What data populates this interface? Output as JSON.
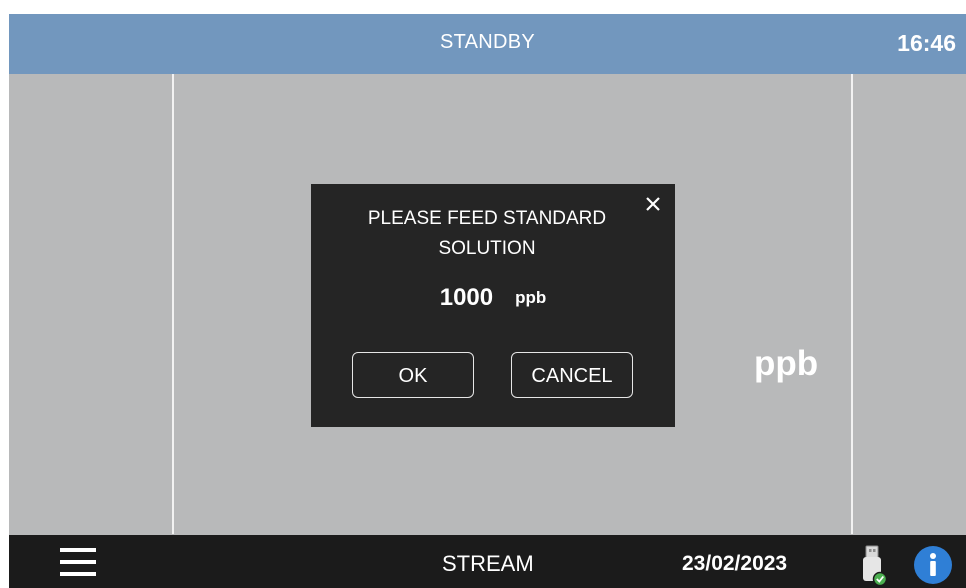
{
  "header": {
    "status": "STANDBY",
    "time": "16:46"
  },
  "main": {
    "unit_label": "ppb"
  },
  "dialog": {
    "message_line1": "PLEASE FEED STANDARD",
    "message_line2": "SOLUTION",
    "value": "1000",
    "unit": "ppb",
    "ok_label": "OK",
    "cancel_label": "CANCEL",
    "close_icon": "close-icon"
  },
  "footer": {
    "menu_icon": "hamburger-menu-icon",
    "stream_label": "STREAM",
    "date": "23/02/2023",
    "usb_icon": "usb-drive-connected-icon",
    "info_icon": "info-icon"
  },
  "colors": {
    "header_bg": "#7297be",
    "main_bg": "#b8b9ba",
    "dialog_bg": "#252525",
    "footer_bg": "#1b1b1b",
    "info_blue": "#2f7fd6",
    "usb_check_green": "#4caf50"
  }
}
